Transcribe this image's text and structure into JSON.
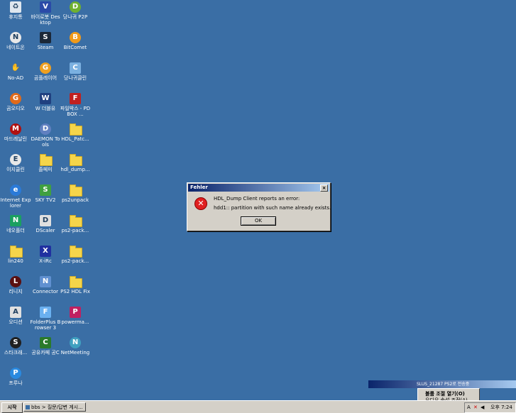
{
  "desktop": {
    "background": "#3a6ea5",
    "icons": [
      {
        "label": "휴지통",
        "icon": "recycle-bin-icon"
      },
      {
        "label": "바이로봇 Desktop",
        "icon": "virobot-icon"
      },
      {
        "label": "당나귀 P2P",
        "icon": "donkey-p2p-icon"
      },
      {
        "label": "네이트온",
        "icon": "nateon-icon"
      },
      {
        "label": "Steam",
        "icon": "steam-icon"
      },
      {
        "label": "BitComet",
        "icon": "bitcomet-icon"
      },
      {
        "label": "No-AD",
        "icon": "no-ad-icon"
      },
      {
        "label": "곰플레이어",
        "icon": "gom-player-icon"
      },
      {
        "label": "당나귀클린",
        "icon": "donkey-clean-icon"
      },
      {
        "label": "곰오디오",
        "icon": "gom-audio-icon"
      },
      {
        "label": "W 더블유",
        "icon": "w-icon"
      },
      {
        "label": "파일박스 - PDBOX ...",
        "icon": "pdbox-icon"
      },
      {
        "label": "마드레날린",
        "icon": "madrenalin-icon"
      },
      {
        "label": "DAEMON Tools",
        "icon": "daemon-tools-icon"
      },
      {
        "label": "HDL_Patc...",
        "icon": "folder-icon"
      },
      {
        "label": "이지클린",
        "icon": "easyclean-icon"
      },
      {
        "label": "졸페미",
        "icon": "folder-icon"
      },
      {
        "label": "hdl_dump...",
        "icon": "folder-icon"
      },
      {
        "label": "Internet Explorer",
        "icon": "internet-explorer-icon"
      },
      {
        "label": "SKY TV2",
        "icon": "sky-tv-icon"
      },
      {
        "label": "ps2unpack",
        "icon": "folder-icon"
      },
      {
        "label": "네오플더",
        "icon": "neo-icon"
      },
      {
        "label": "DScaler",
        "icon": "dscaler-icon"
      },
      {
        "label": "ps2-pack...",
        "icon": "folder-icon"
      },
      {
        "label": "lin240",
        "icon": "folder-icon"
      },
      {
        "label": "X-iRc",
        "icon": "x-irc-icon"
      },
      {
        "label": "ps2-pack...",
        "icon": "folder-icon"
      },
      {
        "label": "리니지",
        "icon": "lineage-icon"
      },
      {
        "label": "Connector",
        "icon": "connector-icon"
      },
      {
        "label": "PS2 HDL Fix",
        "icon": "folder-icon"
      },
      {
        "label": "오디션",
        "icon": "audition-icon"
      },
      {
        "label": "FolderPlus Browser 3",
        "icon": "folderplus-icon"
      },
      {
        "label": "powerma...",
        "icon": "powermax-icon"
      },
      {
        "label": "스타크래...",
        "icon": "starcraft-icon"
      },
      {
        "label": "공유카페 공C",
        "icon": "gongc-icon"
      },
      {
        "label": "NetMeeting",
        "icon": "netmeeting-icon"
      },
      {
        "label": "프루나",
        "icon": "pruna-icon"
      }
    ]
  },
  "dialog": {
    "title": "Fehler",
    "close_glyph": "×",
    "error_glyph": "✕",
    "line1": "HDL_Dump Client reports an error:",
    "line2": "hdd1:: partition with such name already exists.",
    "ok_label": "OK"
  },
  "ime": {
    "title": "SLUS_21287 PS2로 전송중"
  },
  "volume_popup": {
    "item1": "볼륨 조절 열기(O)",
    "item2": "오디오 속성 조정(A)"
  },
  "taskbar": {
    "start_label": "시작",
    "task_label": "bbs > 질문/답변 게시...",
    "tray_a": "A",
    "tray_x": "✕",
    "tray_speaker": "◀",
    "clock": "오후 7:24"
  }
}
